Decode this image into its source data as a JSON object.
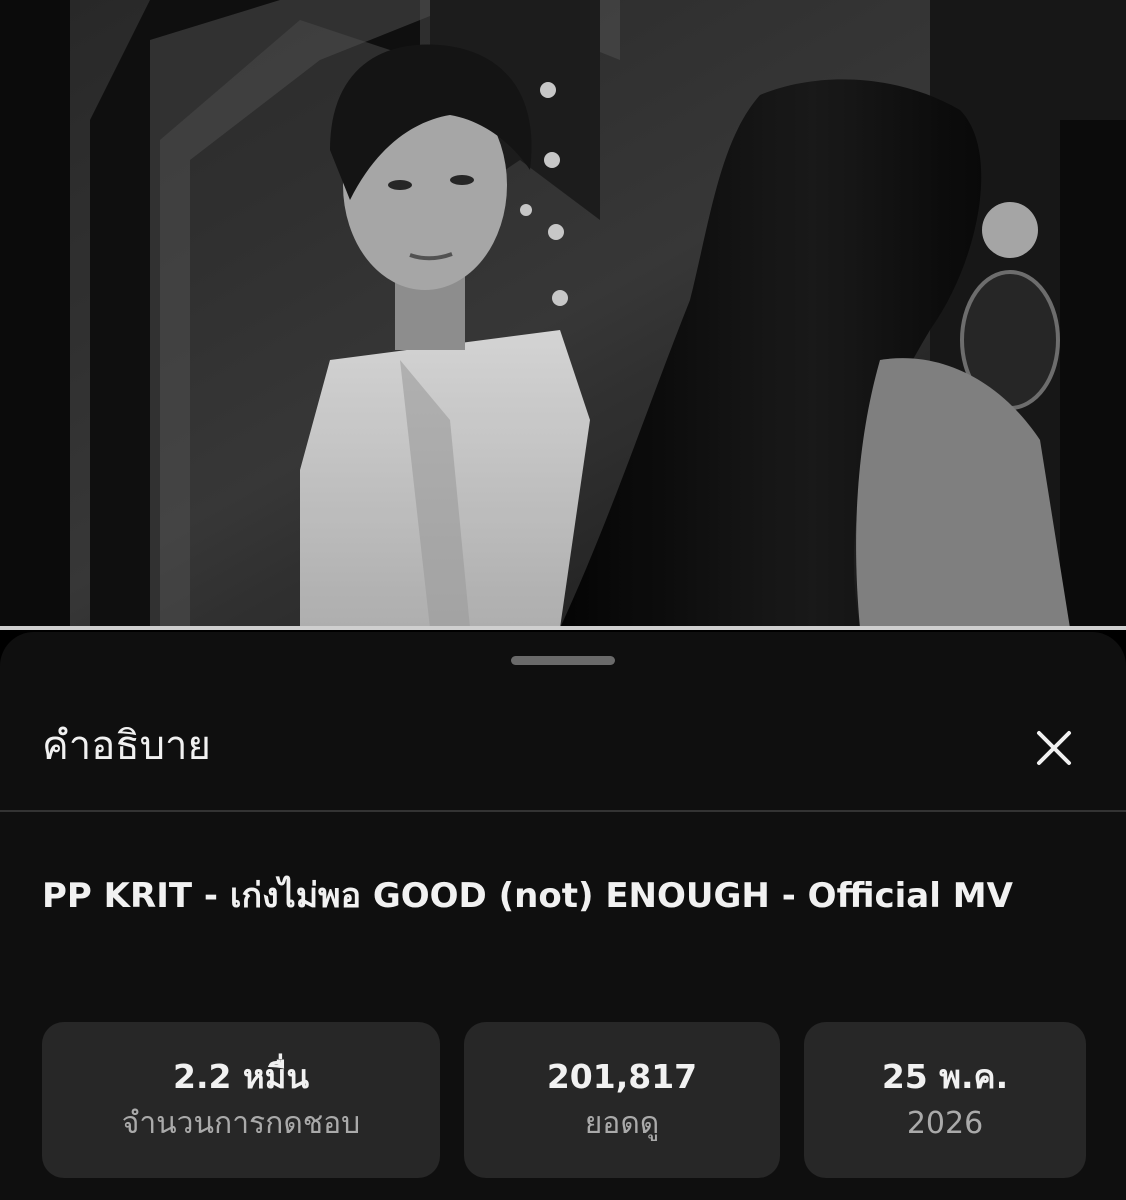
{
  "player": {
    "progress_fraction": 1.0
  },
  "sheet": {
    "title": "คำอธิบาย",
    "close_icon": "close-icon"
  },
  "video": {
    "title": "PP KRIT - เก่งไม่พอ GOOD (not) ENOUGH - Official MV"
  },
  "stats": [
    {
      "value": "2.2 หมื่น",
      "label": "จำนวนการกดชอบ"
    },
    {
      "value": "201,817",
      "label": "ยอดดู"
    },
    {
      "value": "25 พ.ค.",
      "label": "2026"
    }
  ],
  "colors": {
    "sheet_bg": "#0f0f0f",
    "card_bg": "#272727",
    "text_primary": "#f1f1f1",
    "text_secondary": "#aaaaaa"
  }
}
